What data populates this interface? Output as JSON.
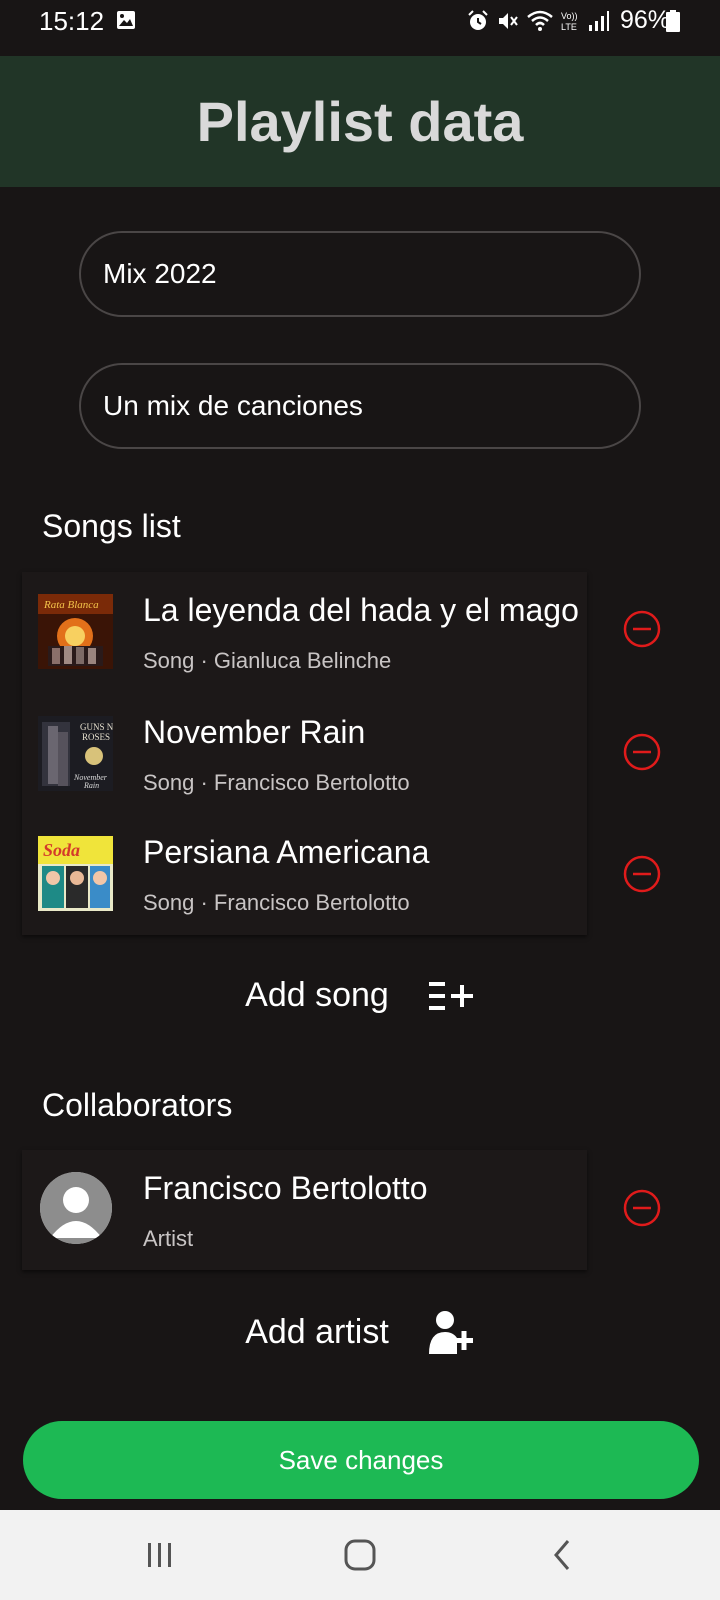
{
  "status_bar": {
    "time": "15:12",
    "battery": "96%",
    "icons": [
      "image-icon",
      "alarm-icon",
      "mute-icon",
      "wifi-icon",
      "volte-icon",
      "signal-icon",
      "battery-icon"
    ]
  },
  "header": {
    "title": "Playlist data"
  },
  "form": {
    "name_value": "Mix 2022",
    "description_value": "Un mix de canciones"
  },
  "songs": {
    "title": "Songs list",
    "items": [
      {
        "title": "La leyenda del hada y el mago",
        "subtitle": "Song · Gianluca Belinche"
      },
      {
        "title": "November Rain",
        "subtitle": "Song · Francisco Bertolotto"
      },
      {
        "title": "Persiana Americana",
        "subtitle": "Song · Francisco Bertolotto"
      }
    ],
    "add_label": "Add song"
  },
  "collaborators": {
    "title": "Collaborators",
    "items": [
      {
        "name": "Francisco Bertolotto",
        "role": "Artist"
      }
    ],
    "add_label": "Add artist"
  },
  "save_label": "Save changes",
  "colors": {
    "background": "#181515",
    "header": "#213527",
    "accent": "#1db954",
    "remove": "#e01b1b"
  }
}
